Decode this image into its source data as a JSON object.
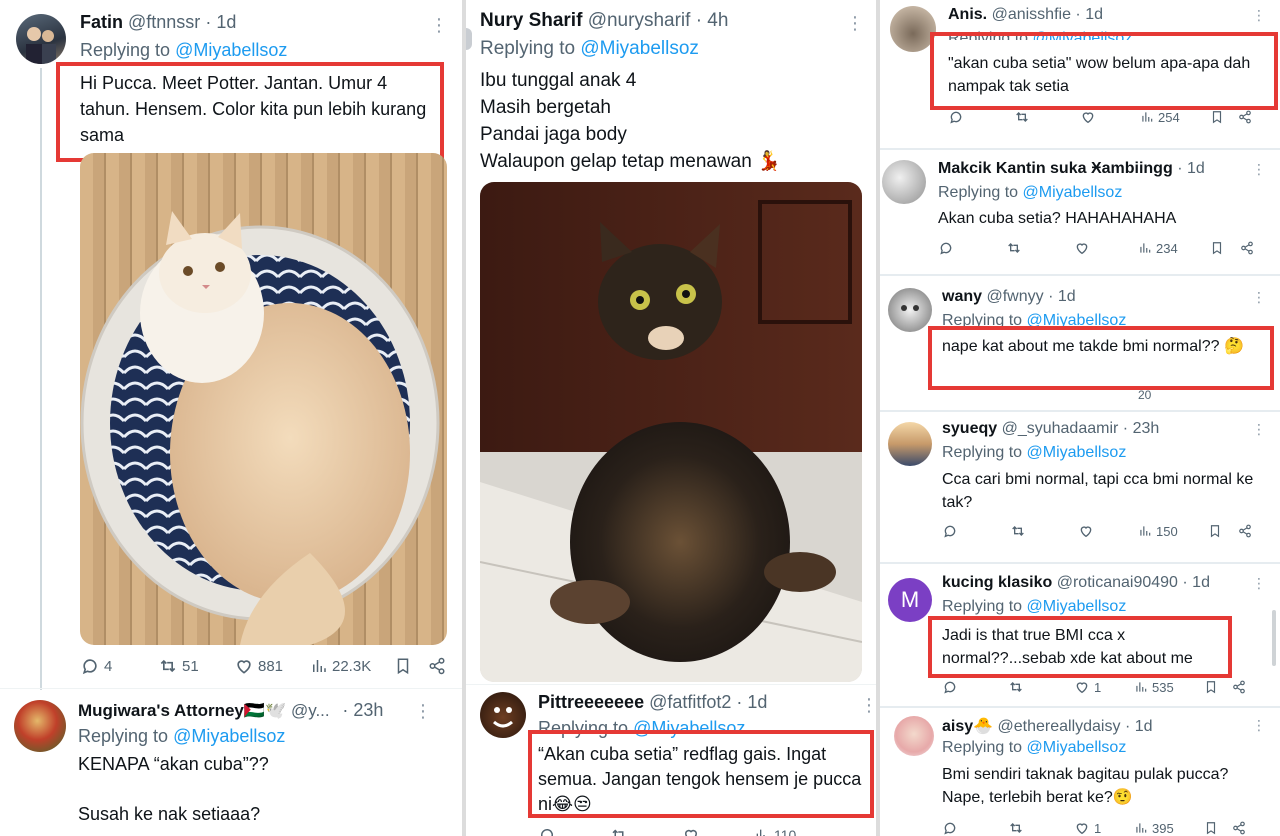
{
  "col1": {
    "tweet1": {
      "name": "Fatin",
      "handle": "@ftnnssr",
      "time": "· 1d",
      "replying_prefix": "Replying to",
      "replying_to": "@Miyabellsoz",
      "text": "Hi Pucca. Meet Potter. Jantan. Umur 4 tahun. Hensem. Color kita pun lebih kurang sama",
      "replies": "4",
      "retweets": "51",
      "likes": "881",
      "views": "22.3K",
      "image_alt": "cream cat in a rope basket"
    },
    "tweet2": {
      "name": "Mugiwara's Attorney🇵🇸🕊️",
      "handle": "@y...",
      "time": "· 23h",
      "replying_prefix": "Replying to",
      "replying_to": "@Miyabellsoz",
      "text_line1": "KENAPA “akan cuba”??",
      "text_line2": "Susah ke nak setiaaa?"
    }
  },
  "col2": {
    "tweet1": {
      "name": "Nury Sharif",
      "handle": "@nurysharif",
      "time": "· 4h",
      "replying_prefix": "Replying to",
      "replying_to": "@Miyabellsoz",
      "lines": [
        "Ibu tunggal anak 4",
        "Masih bergetah",
        "Pandai jaga body",
        "Walaupon gelap tetap menawan 💃"
      ],
      "image_alt": "tortoiseshell cat lying on floor"
    },
    "tweet2": {
      "name": "Pittreeeeeee",
      "handle": "@fatfitfot2",
      "time": "· 1d",
      "replying_prefix": "Replying to",
      "replying_to": "@Miyabellsoz",
      "text": "“Akan cuba setia” redflag gais. Ingat semua. Jangan tengok hensem je pucca ni😂😒",
      "views": "110"
    }
  },
  "col3": {
    "tweets": [
      {
        "name": "Anis.",
        "handle": "@anisshfie",
        "time": "· 1d",
        "replying_prefix": "Replying to",
        "replying_to": "@Miyabellsoz",
        "text": "\"akan cuba setia\" wow belum apa-apa dah nampak tak setia",
        "views": "254"
      },
      {
        "name": "Makcik Kantin suka Ӿambiingg",
        "handle": "",
        "time": "· 1d",
        "replying_prefix": "Replying to",
        "replying_to": "@Miyabellsoz",
        "text": "Akan cuba setia? HAHAHAHAHA",
        "views": "234"
      },
      {
        "name": "wany",
        "handle": "@fwnyy",
        "time": "· 1d",
        "replying_prefix": "Replying to",
        "replying_to": "@Miyabellsoz",
        "text": "nape kat about me takde bmi normal?? 🤔",
        "views": "20"
      },
      {
        "name": "syueqy",
        "handle": "@_syuhadaamir",
        "time": "· 23h",
        "replying_prefix": "Replying to",
        "replying_to": "@Miyabellsoz",
        "text": "Cca cari bmi normal, tapi cca bmi normal ke tak?",
        "views": "150"
      },
      {
        "name": "kucing klasiko",
        "handle": "@roticanai90490",
        "time": "· 1d",
        "replying_prefix": "Replying to",
        "replying_to": "@Miyabellsoz",
        "text": "Jadi is that true BMI cca x normal??...sebab xde kat about me",
        "likes": "1",
        "views": "535",
        "avatar_letter": "M"
      },
      {
        "name": "aisy🐣",
        "handle": "@ethereallydaisy",
        "time": "· 1d",
        "replying_prefix": "Replying to",
        "replying_to": "@Miyabellsoz",
        "text": "Bmi sendiri taknak bagitau pulak pucca? Nape, terlebih berat ke?🤨",
        "likes": "1",
        "views": "395"
      }
    ]
  },
  "colors": {
    "link": "#1d9bf0",
    "secondary": "#536471",
    "highlight_border": "#e53935",
    "avatar_m": "#7b3fc4"
  }
}
